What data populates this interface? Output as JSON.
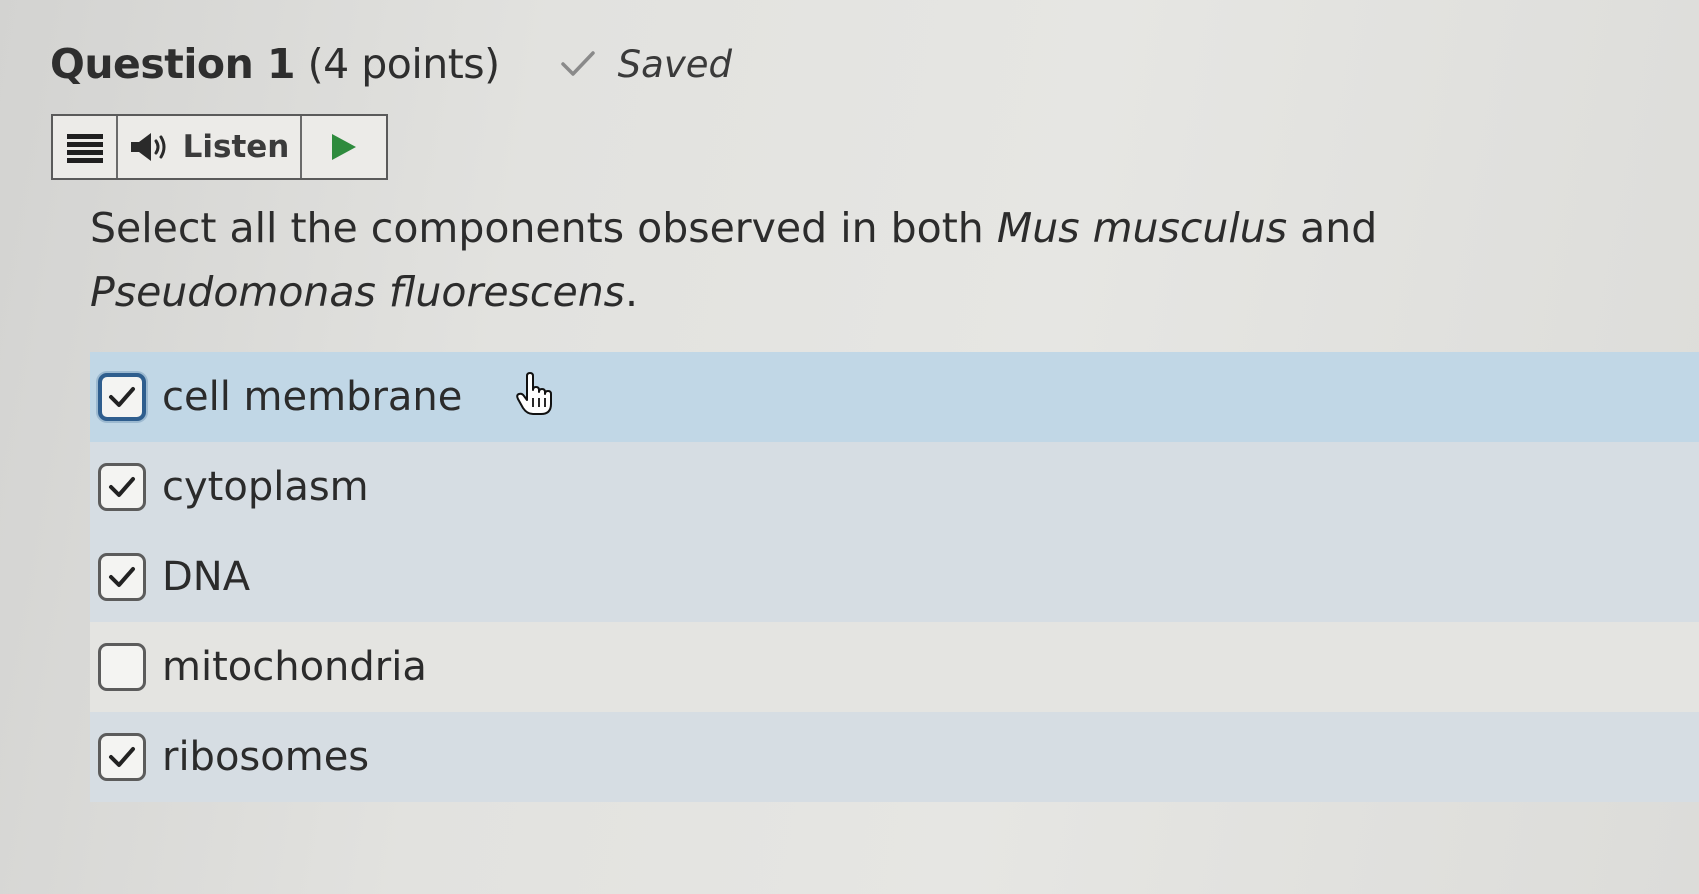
{
  "question": {
    "title_number": "Question 1",
    "points": "(4 points)",
    "status": "Saved",
    "status_icon": "checkmark-icon"
  },
  "toolbar": {
    "menu_icon": "menu-icon",
    "speaker_icon": "speaker-icon",
    "listen_label": "Listen",
    "play_icon": "play-icon",
    "play_color": "#2e8b3d"
  },
  "prompt": {
    "part1": "Select all the components observed in both ",
    "species1": "Mus musculus",
    "part2": " and ",
    "species2": "Pseudomonas fluorescens",
    "part3": "."
  },
  "options": [
    {
      "label": "cell membrane",
      "checked": true,
      "focused": true
    },
    {
      "label": "cytoplasm",
      "checked": true,
      "focused": false
    },
    {
      "label": "DNA",
      "checked": true,
      "focused": false
    },
    {
      "label": "mitochondria",
      "checked": false,
      "focused": false
    },
    {
      "label": "ribosomes",
      "checked": true,
      "focused": false
    }
  ],
  "colors": {
    "focused_row": "#c1d7e6",
    "row": "#d6dde3",
    "focus_border": "#2f5e8e"
  }
}
